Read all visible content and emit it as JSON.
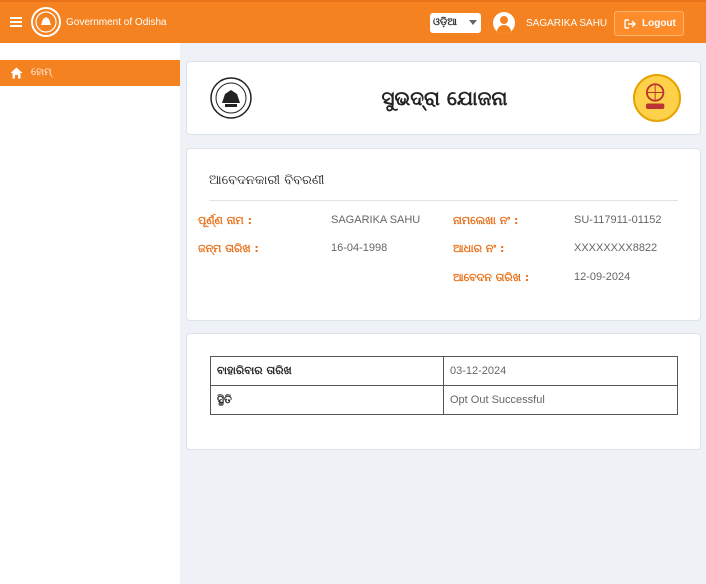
{
  "header": {
    "brand": "Government of Odisha",
    "language": "ଓଡ଼ିଆ",
    "user_name": "SAGARIKA SAHU",
    "logout_label": "Logout"
  },
  "sidebar": {
    "items": [
      {
        "label": "ହୋମ୍",
        "icon": "home-icon",
        "active": true
      }
    ]
  },
  "scheme": {
    "title": "ସୁଭଦ୍ରା ଯୋଜନା"
  },
  "applicant": {
    "section_title": "ଆବେଦନକାରୀ ବିବରଣୀ",
    "fields": {
      "full_name_label": "ପୂର୍ଣ୍ଣ ନାମ :",
      "full_name": "SAGARIKA SAHU",
      "dob_label": "ଜନ୍ମ ତାରିଖ :",
      "dob": "16-04-1998",
      "reg_no_label": "ନାମଲେଖା ନଂ :",
      "reg_no": "SU-117911-01152",
      "aadhaar_label": "ଆଧାର ନଂ :",
      "aadhaar": "XXXXXXXX8822",
      "apply_date_label": "ଆବେଦନ ତାରିଖ :",
      "apply_date": "12-09-2024"
    }
  },
  "status_table": {
    "rows": [
      {
        "key": "ବାହାରିବାର ତାରିଖ",
        "value": "03-12-2024"
      },
      {
        "key": "ସ୍ଥିତି",
        "value": "Opt Out Successful"
      }
    ]
  },
  "colors": {
    "accent": "#f58220",
    "label": "#e8711a",
    "background": "#eef2f7"
  }
}
